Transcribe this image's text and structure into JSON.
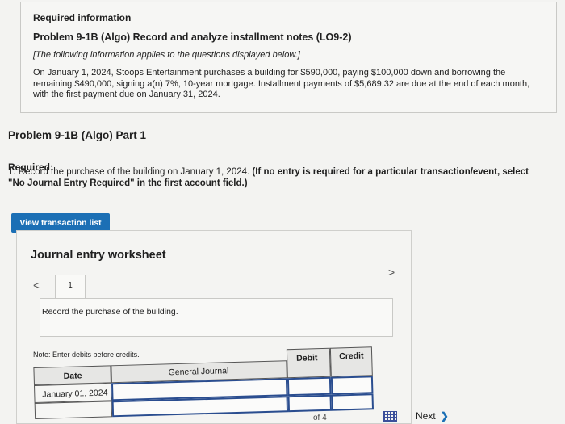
{
  "info": {
    "required_information": "Required information",
    "problem_title": "Problem 9-1B (Algo) Record and analyze installment notes (LO9-2)",
    "note": "[The following information applies to the questions displayed below.]",
    "scenario": "On January 1, 2024, Stoops Entertainment purchases a building for $590,000, paying $100,000 down and borrowing the remaining $490,000, signing a(n) 7%, 10-year mortgage. Installment payments of $5,689.32 are due at the end of each month, with the first payment due on January 31, 2024."
  },
  "part_title": "Problem 9-1B (Algo) Part 1",
  "required": {
    "label": "Required:",
    "instruction": "1. Record the purchase of the building on January 1, 2024.",
    "bold_note": "(If no entry is required for a particular transaction/event, select \"No Journal Entry Required\" in the first account field.)"
  },
  "view_transaction_button": "View transaction list",
  "worksheet": {
    "title": "Journal entry worksheet",
    "nav_prev": "<",
    "nav_next": ">",
    "current_tab": "1",
    "description": "Record the purchase of the building.",
    "note": "Note: Enter debits before credits.",
    "columns": {
      "date": "Date",
      "general_journal": "General Journal",
      "debit": "Debit",
      "credit": "Credit"
    },
    "rows": [
      {
        "date": "January 01, 2024"
      }
    ]
  },
  "pagination": {
    "of_text": "of 4"
  },
  "next_button": "Next",
  "icons": {
    "prev": "chevron-left-icon",
    "next": "chevron-right-icon",
    "grid": "grid-icon"
  },
  "colors": {
    "button_blue": "#1b6fb5"
  }
}
